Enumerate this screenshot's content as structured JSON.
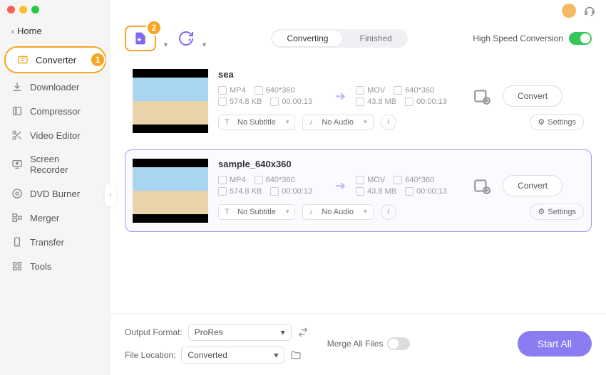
{
  "home_label": "Home",
  "sidebar": {
    "items": [
      {
        "icon": "converter",
        "label": "Converter",
        "active": true
      },
      {
        "icon": "downloader",
        "label": "Downloader"
      },
      {
        "icon": "compressor",
        "label": "Compressor"
      },
      {
        "icon": "video-editor",
        "label": "Video Editor"
      },
      {
        "icon": "screen-recorder",
        "label": "Screen Recorder"
      },
      {
        "icon": "dvd-burner",
        "label": "DVD Burner"
      },
      {
        "icon": "merger",
        "label": "Merger"
      },
      {
        "icon": "transfer",
        "label": "Transfer"
      },
      {
        "icon": "tools",
        "label": "Tools"
      }
    ]
  },
  "badges": {
    "one": "1",
    "two": "2"
  },
  "tabs": {
    "converting": "Converting",
    "finished": "Finished"
  },
  "high_speed_label": "High Speed Conversion",
  "items": [
    {
      "title": "sea",
      "src_format": "MP4",
      "src_res": "640*360",
      "src_size": "574.8 KB",
      "src_dur": "00:00:13",
      "dst_format": "MOV",
      "dst_res": "640*360",
      "dst_size": "43.8 MB",
      "dst_dur": "00:00:13",
      "subtitle": "No Subtitle",
      "audio": "No Audio",
      "settings": "Settings",
      "convert": "Convert"
    },
    {
      "title": "sample_640x360",
      "src_format": "MP4",
      "src_res": "640*360",
      "src_size": "574.8 KB",
      "src_dur": "00:00:13",
      "dst_format": "MOV",
      "dst_res": "640*360",
      "dst_size": "43.8 MB",
      "dst_dur": "00:00:13",
      "subtitle": "No Subtitle",
      "audio": "No Audio",
      "settings": "Settings",
      "convert": "Convert"
    }
  ],
  "footer": {
    "output_format_label": "Output Format:",
    "output_format_value": "ProRes",
    "file_location_label": "File Location:",
    "file_location_value": "Converted",
    "merge_label": "Merge All Files",
    "start_all": "Start All"
  }
}
